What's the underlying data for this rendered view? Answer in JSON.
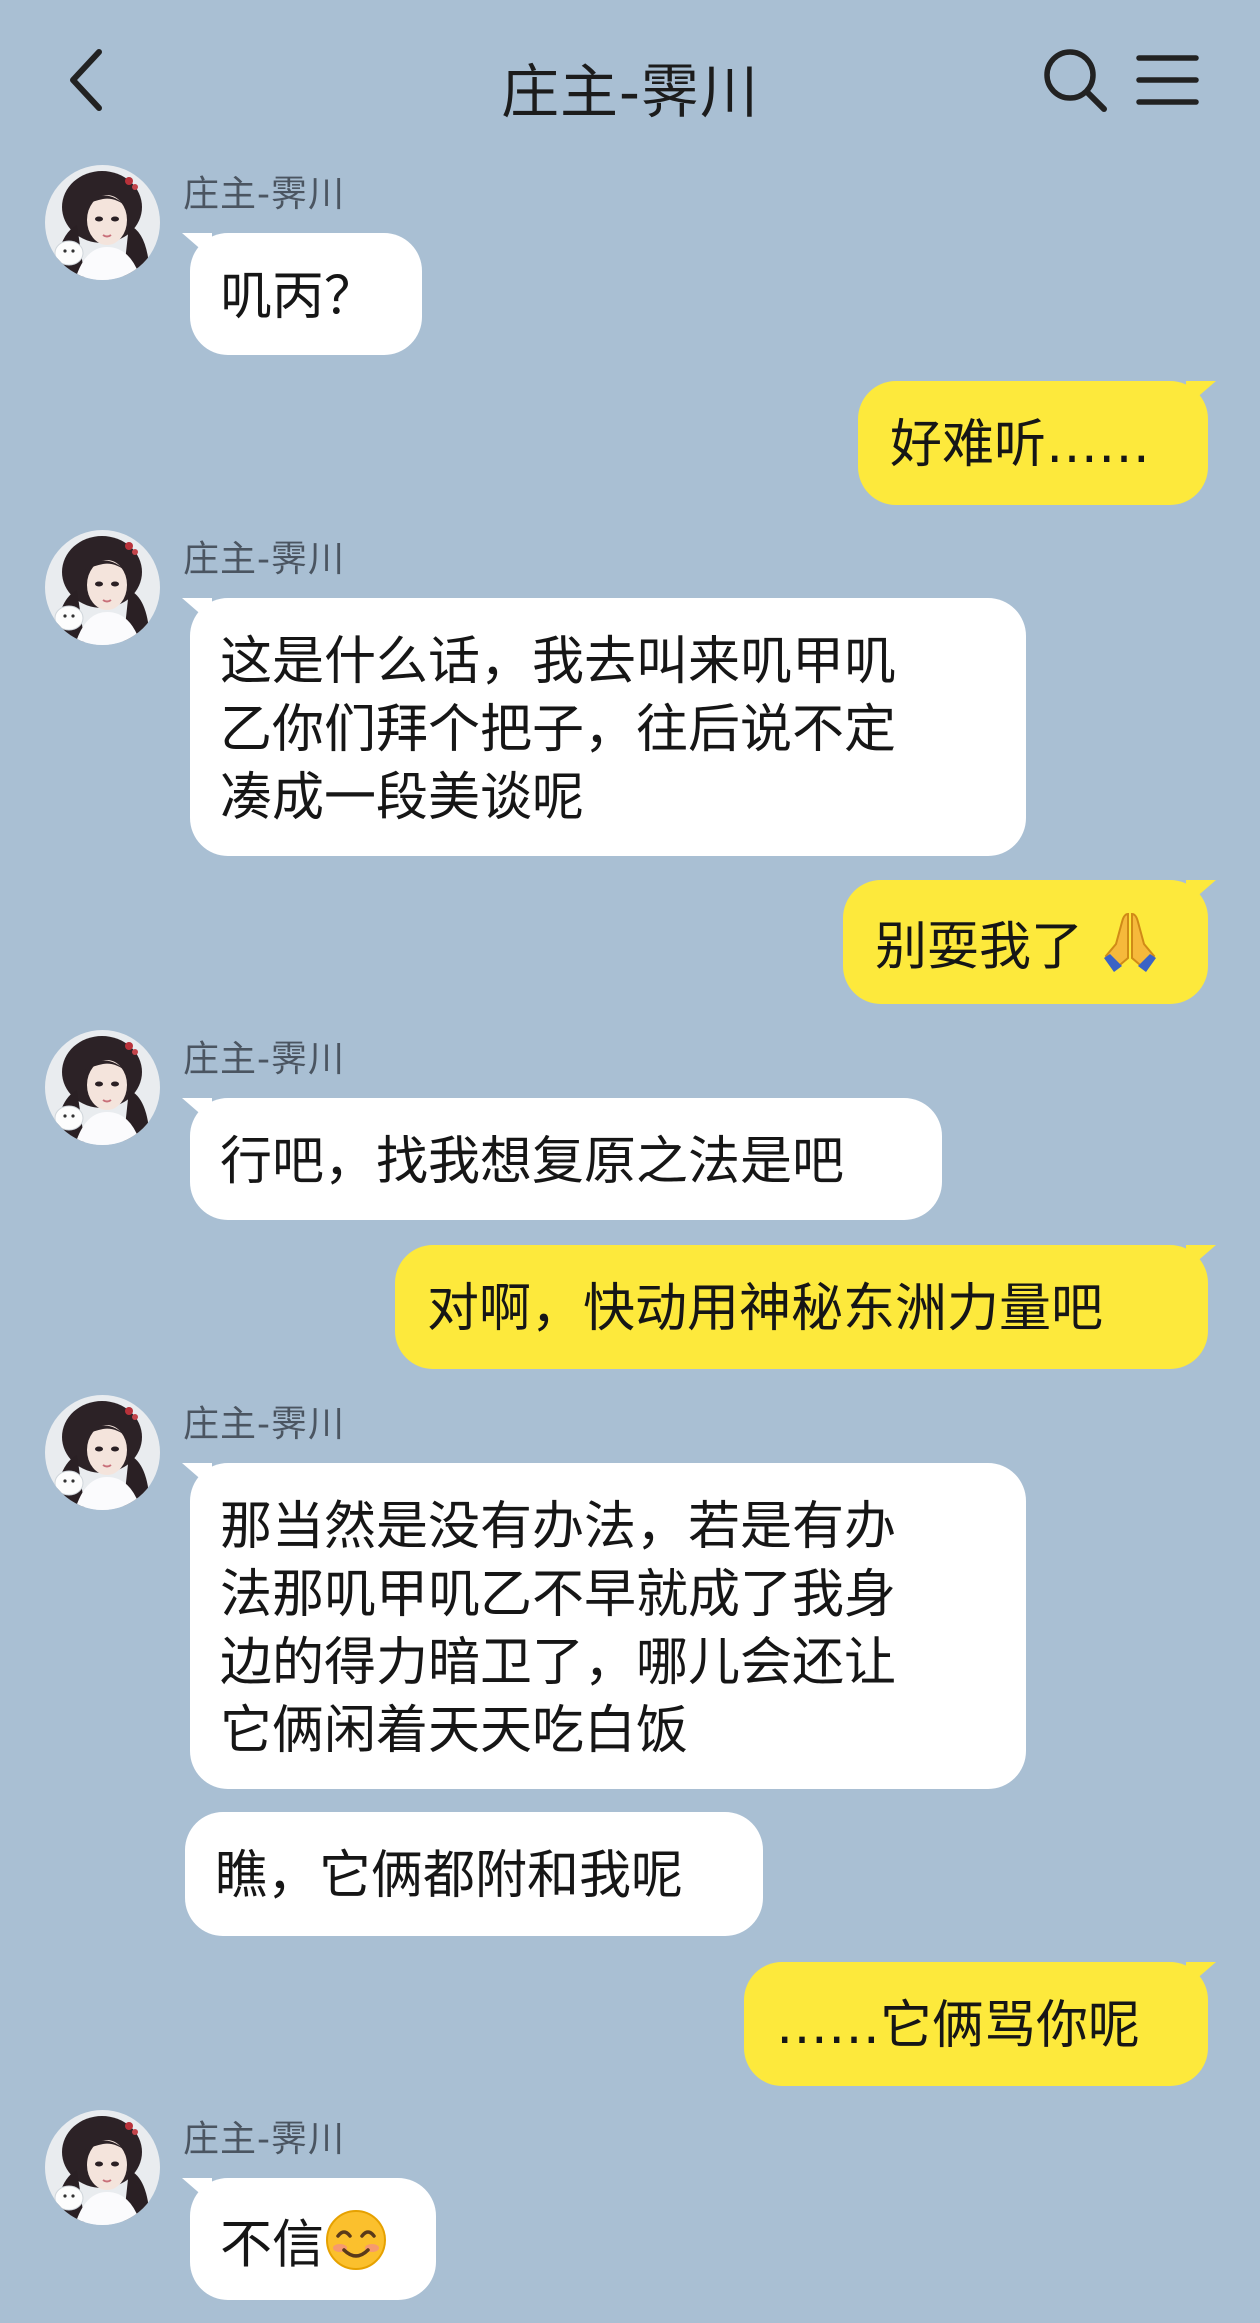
{
  "header": {
    "title": "庄主-霁川",
    "back_icon": "chevron-left-icon",
    "search_icon": "search-icon",
    "menu_icon": "menu-icon"
  },
  "colors": {
    "background": "#a9bfd3",
    "incoming_bubble": "#ffffff",
    "outgoing_bubble": "#fde93c",
    "sender_name": "#4b5561"
  },
  "messages": [
    {
      "direction": "in",
      "sender": "庄主-霁川",
      "text": "叽丙？"
    },
    {
      "direction": "out",
      "text": "好难听……"
    },
    {
      "direction": "in",
      "sender": "庄主-霁川",
      "text": "这是什么话，我去叫来叽甲叽\n乙你们拜个把子，往后说不定\n凑成一段美谈呢"
    },
    {
      "direction": "out",
      "text": "别耍我了",
      "emoji": "folded-hands-emoji"
    },
    {
      "direction": "in",
      "sender": "庄主-霁川",
      "text": "行吧，找我想复原之法是吧"
    },
    {
      "direction": "out",
      "text": "对啊，快动用神秘东洲力量吧"
    },
    {
      "direction": "in",
      "sender": "庄主-霁川",
      "text": "那当然是没有办法，若是有办\n法那叽甲叽乙不早就成了我身\n边的得力暗卫了，哪儿会还让\n它俩闲着天天吃白饭"
    },
    {
      "direction": "in",
      "text": "瞧，它俩都附和我呢"
    },
    {
      "direction": "out",
      "text": "……它俩骂你呢"
    },
    {
      "direction": "in",
      "sender": "庄主-霁川",
      "text": "不信",
      "emoji": "smiling-face-emoji"
    }
  ]
}
